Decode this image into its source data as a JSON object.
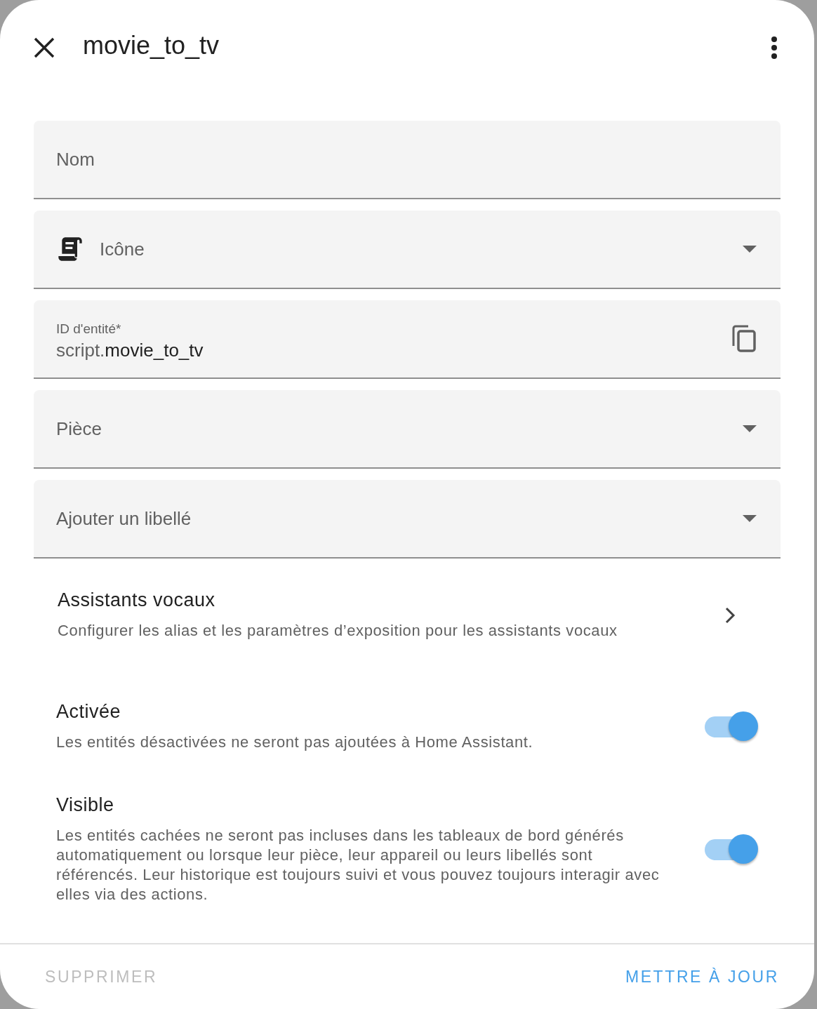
{
  "dialog": {
    "title": "movie_to_tv"
  },
  "fields": [
    {
      "kind": "text",
      "label": "Nom"
    },
    {
      "kind": "icon-select",
      "label": "Icône"
    },
    {
      "kind": "entity-id",
      "label": "ID d'entité*",
      "prefix": "script.",
      "value": "movie_to_tv"
    },
    {
      "kind": "select",
      "label": "Pièce"
    },
    {
      "kind": "select",
      "label": "Ajouter un libellé"
    }
  ],
  "voice": {
    "title": "Assistants vocaux",
    "description": "Configurer les alias et les paramètres d’exposition pour les assistants vocaux"
  },
  "toggles": [
    {
      "label": "Activée",
      "description": "Les entités désactivées ne seront pas ajoutées à Home Assistant.",
      "on": true
    },
    {
      "label": "Visible",
      "description": "Les entités cachées ne seront pas incluses dans les tableaux de bord générés automatiquement ou lorsque leur pièce, leur appareil ou leurs libellés sont référencés. Leur historique est toujours suivi et vous pouvez toujours interagir avec elles via des actions.",
      "on": true
    }
  ],
  "footer": {
    "delete": {
      "label": "SUPPRIMER",
      "disabled": true
    },
    "update": {
      "label": "METTRE À JOUR",
      "disabled": false
    }
  }
}
